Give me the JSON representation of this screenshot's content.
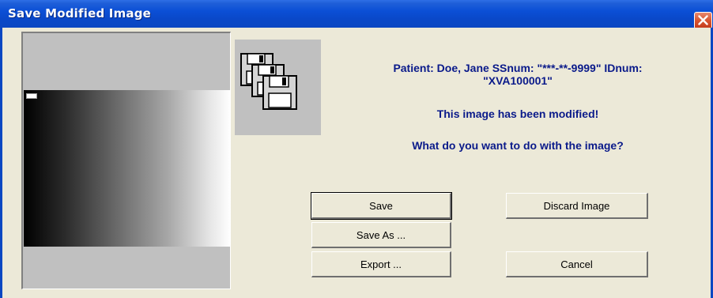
{
  "window": {
    "title": "Save Modified Image"
  },
  "message": {
    "patient_line1": "Patient: Doe, Jane  SSnum: \"***-**-9999\"  IDnum:",
    "patient_line2": "\"XVA100001\"",
    "modified": "This image has been modified!",
    "question": "What do you want to do with the image?"
  },
  "buttons": {
    "save": "Save",
    "save_as": "Save As ...",
    "export": "Export ...",
    "discard": "Discard Image",
    "cancel": "Cancel"
  },
  "icons": {
    "close": "close-icon",
    "floppies": "floppy-disks-icon"
  },
  "colors": {
    "title_bar": "#0b4fd6",
    "dialog_bg": "#ece9d8",
    "message_text": "#0a1a8a",
    "close_button": "#d8542f"
  }
}
